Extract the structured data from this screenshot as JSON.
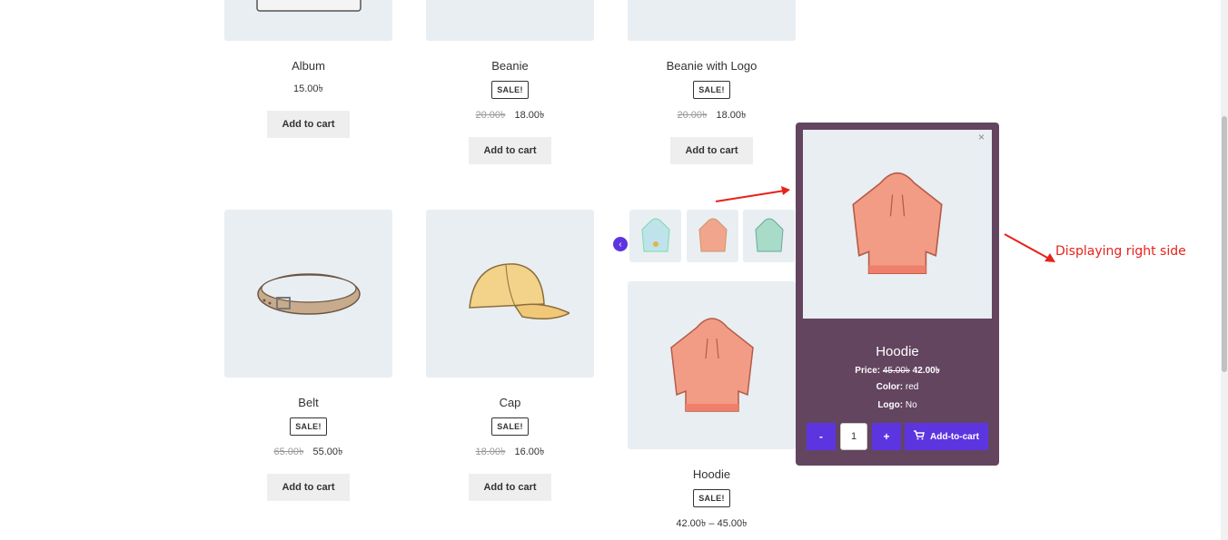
{
  "products": [
    {
      "id": "album",
      "name": "Album",
      "sale": "",
      "regular": "",
      "price": "15.00৳",
      "button": "Add to cart",
      "icon": "album-image"
    },
    {
      "id": "beanie",
      "name": "Beanie",
      "sale": "SALE!",
      "regular": "20.00৳",
      "price": "18.00৳",
      "button": "Add to cart",
      "icon": "beanie-image"
    },
    {
      "id": "beanie-logo",
      "name": "Beanie with Logo",
      "sale": "SALE!",
      "regular": "20.00৳",
      "price": "18.00৳",
      "button": "Add to cart",
      "icon": "beanie-logo-image"
    },
    {
      "id": "belt",
      "name": "Belt",
      "sale": "SALE!",
      "regular": "65.00৳",
      "price": "55.00৳",
      "button": "Add to cart",
      "icon": "belt-image"
    },
    {
      "id": "cap",
      "name": "Cap",
      "sale": "SALE!",
      "regular": "18.00৳",
      "price": "16.00৳",
      "button": "Add to cart",
      "icon": "cap-image"
    },
    {
      "id": "hoodie",
      "name": "Hoodie",
      "sale": "SALE!",
      "range": "42.00৳ – 45.00৳",
      "icon": "hoodie-image"
    }
  ],
  "popup": {
    "close": "×",
    "title": "Hoodie",
    "price_label": "Price:",
    "price_regular": "45.00৳",
    "price_sale": "42.00৳",
    "color_label": "Color:",
    "color_value": "red",
    "logo_label": "Logo:",
    "logo_value": "No",
    "minus": "-",
    "quantity": "1",
    "plus": "+",
    "add_label": "Add-to-cart",
    "background": "#634560",
    "accent": "#5d35e0"
  },
  "annotation": "Displaying right side",
  "thumbs": [
    "hoodie-blue-thumb",
    "hoodie-red-thumb",
    "hoodie-green-thumb"
  ],
  "colors": {
    "accent": "#5d35e0",
    "image_bg": "#e9eef2",
    "annotation": "#e8221b"
  }
}
